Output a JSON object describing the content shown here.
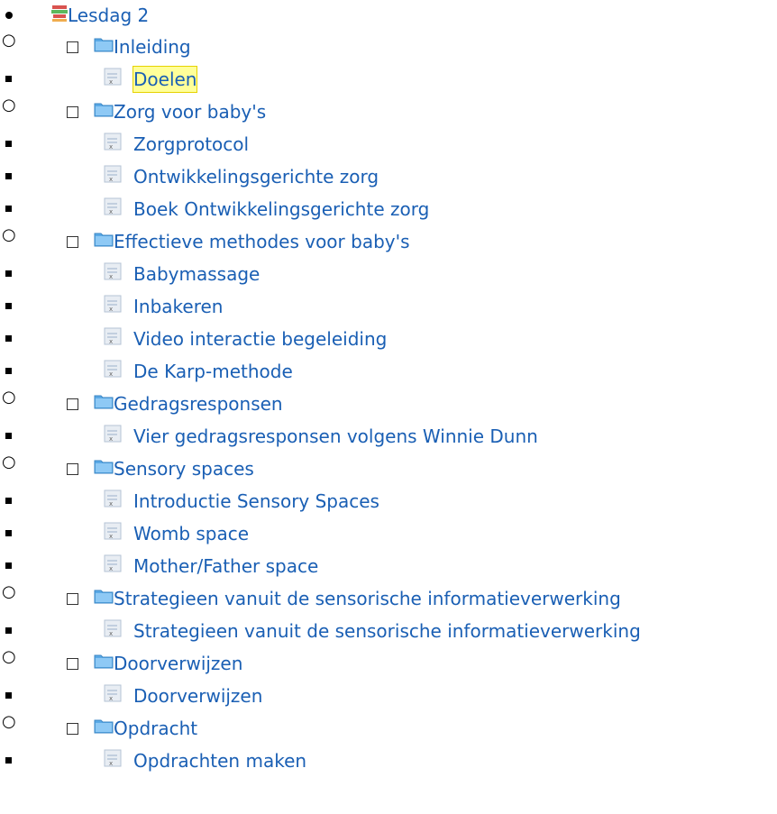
{
  "tree": {
    "root": {
      "label": "Lesdag 2",
      "icon": "books-icon"
    },
    "groups": [
      {
        "label": "Inleiding",
        "icon": "folder-icon",
        "items": [
          {
            "label": "Doelen",
            "icon": "page-icon",
            "selected": true
          }
        ]
      },
      {
        "label": "Zorg voor baby's",
        "icon": "folder-icon",
        "items": [
          {
            "label": "Zorgprotocol",
            "icon": "page-icon"
          },
          {
            "label": "Ontwikkelingsgerichte zorg",
            "icon": "page-icon"
          },
          {
            "label": "Boek Ontwikkelingsgerichte zorg",
            "icon": "page-icon"
          }
        ]
      },
      {
        "label": "Effectieve methodes voor baby's",
        "icon": "folder-icon",
        "items": [
          {
            "label": "Babymassage",
            "icon": "page-icon"
          },
          {
            "label": "Inbakeren",
            "icon": "page-icon"
          },
          {
            "label": "Video interactie begeleiding",
            "icon": "page-icon"
          },
          {
            "label": "De Karp-methode",
            "icon": "page-icon"
          }
        ]
      },
      {
        "label": "Gedragsresponsen",
        "icon": "folder-icon",
        "items": [
          {
            "label": "Vier gedragsresponsen volgens Winnie Dunn",
            "icon": "page-icon"
          }
        ]
      },
      {
        "label": "Sensory spaces",
        "icon": "folder-icon",
        "items": [
          {
            "label": "Introductie Sensory Spaces",
            "icon": "page-icon"
          },
          {
            "label": "Womb space",
            "icon": "page-icon"
          },
          {
            "label": "Mother/Father space",
            "icon": "page-icon"
          }
        ]
      },
      {
        "label": "Strategieen vanuit de sensorische informatieverwerking",
        "icon": "folder-icon",
        "items": [
          {
            "label": "Strategieen vanuit de sensorische informatieverwerking",
            "icon": "page-icon"
          }
        ]
      },
      {
        "label": "Doorverwijzen",
        "icon": "folder-icon",
        "items": [
          {
            "label": "Doorverwijzen",
            "icon": "page-icon"
          }
        ]
      },
      {
        "label": "Opdracht",
        "icon": "folder-icon",
        "items": [
          {
            "label": "Opdrachten maken",
            "icon": "page-icon"
          }
        ]
      }
    ]
  },
  "colors": {
    "link": "#1a5fb4",
    "highlight": "#ffff99"
  }
}
